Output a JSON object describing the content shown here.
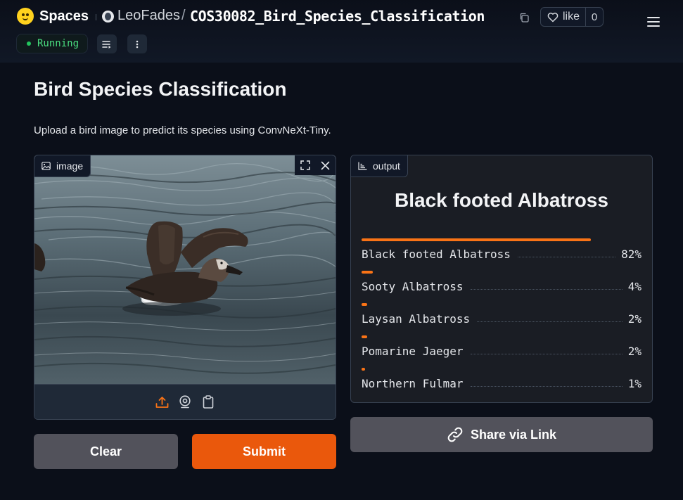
{
  "header": {
    "brand": "Spaces",
    "owner": "LeoFades",
    "separator": "/",
    "repo": "COS30082_Bird_Species_Classification",
    "like_label": "like",
    "like_count": "0",
    "status": "Running"
  },
  "app": {
    "title": "Bird Species Classification",
    "description": "Upload a bird image to predict its species using ConvNeXt-Tiny.",
    "image_label": "image",
    "output_label": "output",
    "prediction": "Black footed Albatross",
    "confidences": [
      {
        "label": "Black footed Albatross",
        "value": "82%",
        "fraction": 0.82
      },
      {
        "label": "Sooty Albatross",
        "value": "4%",
        "fraction": 0.04
      },
      {
        "label": "Laysan Albatross",
        "value": "2%",
        "fraction": 0.02
      },
      {
        "label": "Pomarine Jaeger",
        "value": "2%",
        "fraction": 0.02
      },
      {
        "label": "Northern Fulmar",
        "value": "1%",
        "fraction": 0.01
      }
    ],
    "clear_label": "Clear",
    "submit_label": "Submit",
    "share_label": "Share via Link"
  },
  "colors": {
    "accent": "#ea580c",
    "bar": "#f97316",
    "status_green": "#22c55e",
    "background": "#0b0f19"
  },
  "icons": {
    "brand": "huggingface-logo-icon",
    "copy": "copy-icon",
    "like": "heart-icon",
    "menu": "hamburger-menu-icon",
    "image_tag": "image-icon",
    "output_tag": "bar-chart-icon",
    "fullscreen": "fullscreen-icon",
    "close": "close-icon",
    "upload": "upload-icon",
    "webcam": "webcam-icon",
    "clipboard": "clipboard-icon",
    "share": "link-icon"
  }
}
